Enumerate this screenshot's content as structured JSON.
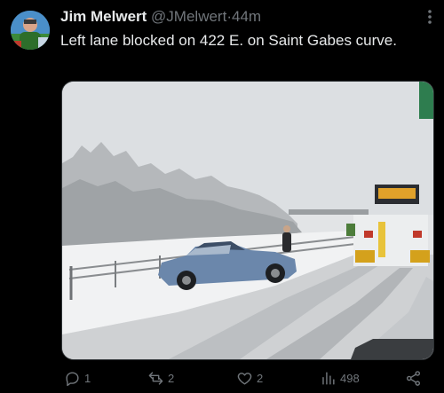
{
  "post": {
    "author_name": "Jim Melwert",
    "handle": "@JMelwert",
    "separator": "·",
    "time": "44m",
    "text": "Left lane blocked on 422 E. on Saint Gabes curve."
  },
  "actions": {
    "replies": "1",
    "reposts": "2",
    "likes": "2",
    "views": "498"
  },
  "icons": {
    "reply": "reply-icon",
    "repost": "repost-icon",
    "like": "heart-icon",
    "views": "views-icon",
    "share": "share-icon",
    "more": "more-icon"
  },
  "colors": {
    "background": "#000000",
    "primary_text": "#e7e9ea",
    "secondary_text": "#71767b"
  }
}
